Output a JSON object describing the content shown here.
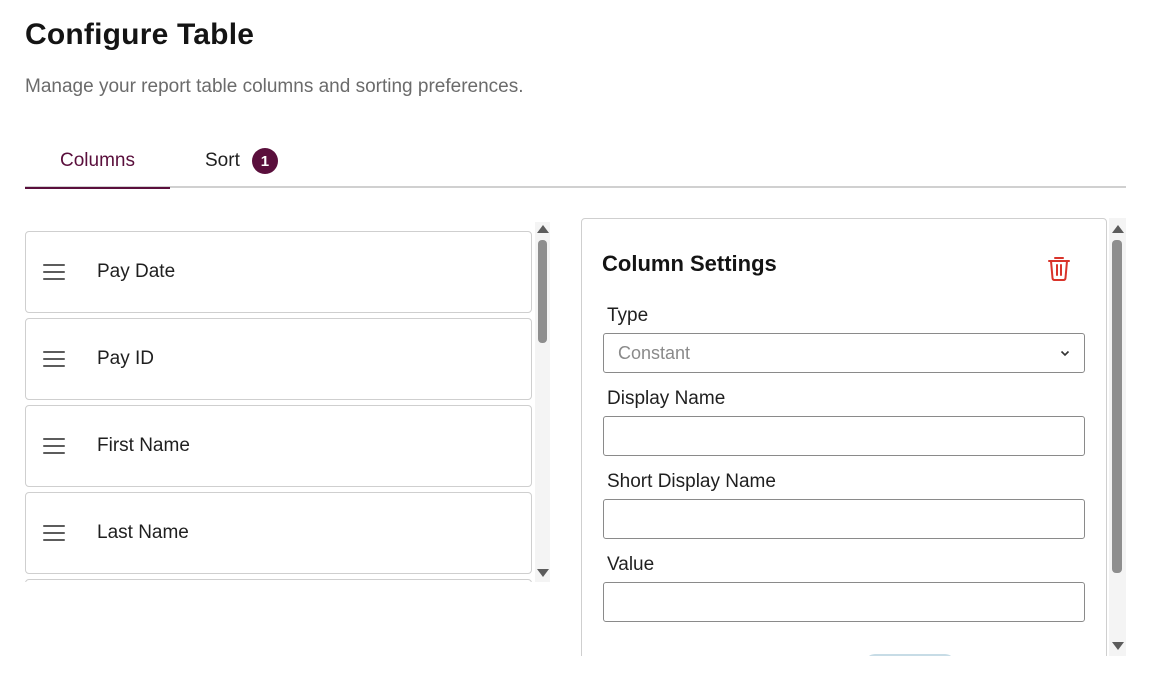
{
  "header": {
    "title": "Configure Table",
    "subtitle": "Manage your report table columns and sorting preferences."
  },
  "tabs": [
    {
      "label": "Columns",
      "active": true
    },
    {
      "label": "Sort",
      "badge": "1"
    }
  ],
  "columns": [
    {
      "label": "Pay Date"
    },
    {
      "label": "Pay ID"
    },
    {
      "label": "First Name"
    },
    {
      "label": "Last Name"
    }
  ],
  "settings": {
    "title": "Column Settings",
    "delete_icon": "trash-icon",
    "type_label": "Type",
    "type_value": "Constant",
    "display_name_label": "Display Name",
    "display_name_value": "",
    "short_display_name_label": "Short Display Name",
    "short_display_name_value": "",
    "value_label": "Value",
    "value_value": ""
  },
  "colors": {
    "accent": "#5a0f3c",
    "delete": "#d9342b"
  }
}
